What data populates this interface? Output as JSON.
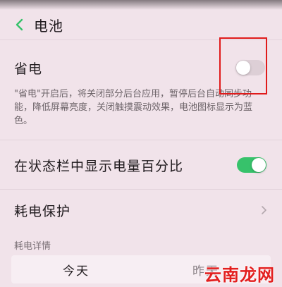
{
  "header": {
    "title": "电池",
    "back_icon": "chevron-left-icon"
  },
  "power_saving": {
    "label": "省电",
    "enabled": false,
    "description": "\"省电\"开启后，将关闭部分后台应用，暂停后台自动同步功能，降低屏幕亮度，关闭触摸震动效果，电池图标显示为蓝色。"
  },
  "show_percentage": {
    "label": "在状态栏中显示电量百分比",
    "enabled": true
  },
  "power_protection": {
    "label": "耗电保护",
    "icon": "chevron-right-icon"
  },
  "details": {
    "section_label": "耗电详情",
    "tabs": [
      {
        "label": "今天",
        "active": true
      },
      {
        "label": "昨天",
        "active": false
      }
    ]
  },
  "watermark": "云南龙网",
  "colors": {
    "accent": "#37c26b",
    "annotation": "#e01b1b",
    "background": "#f1e3ea"
  }
}
